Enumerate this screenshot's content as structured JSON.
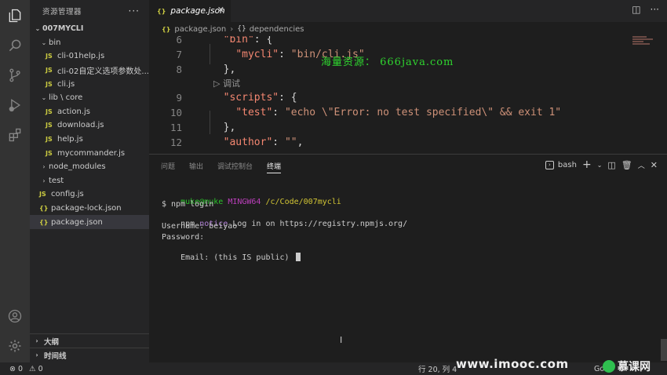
{
  "sidebar": {
    "title": "资源管理器",
    "more": "···",
    "tree": [
      {
        "label": "007MYCLI",
        "kind": "root",
        "chev": "⌄",
        "indent": 4
      },
      {
        "label": "bin",
        "kind": "folder",
        "chev": "⌄",
        "indent": 12
      },
      {
        "label": "cli-01help.js",
        "kind": "js",
        "indent": 20
      },
      {
        "label": "cli-02自定义选项参数处...",
        "kind": "js",
        "indent": 20
      },
      {
        "label": "cli.js",
        "kind": "js",
        "indent": 20
      },
      {
        "label": "lib \\ core",
        "kind": "folder",
        "chev": "⌄",
        "indent": 12
      },
      {
        "label": "action.js",
        "kind": "js",
        "indent": 20
      },
      {
        "label": "download.js",
        "kind": "js",
        "indent": 20
      },
      {
        "label": "help.js",
        "kind": "js",
        "indent": 20
      },
      {
        "label": "mycommander.js",
        "kind": "js",
        "indent": 20
      },
      {
        "label": "node_modules",
        "kind": "folder",
        "chev": "›",
        "indent": 12
      },
      {
        "label": "test",
        "kind": "folder",
        "chev": "›",
        "indent": 12
      },
      {
        "label": "config.js",
        "kind": "js",
        "indent": 12
      },
      {
        "label": "package-lock.json",
        "kind": "json",
        "indent": 12
      },
      {
        "label": "package.json",
        "kind": "json",
        "indent": 12,
        "selected": true
      }
    ],
    "outline_label": "大纲",
    "timeline_label": "时间线"
  },
  "tab": {
    "icon": "{}",
    "label": "package.json",
    "close": "✕"
  },
  "breadcrumb": {
    "file": "package.json",
    "section_icon": "{}",
    "section": "dependencies"
  },
  "editor": {
    "lines": [
      {
        "num": "6",
        "indent": "  ",
        "key": "\"bin\"",
        "rest": ": {"
      },
      {
        "num": "7",
        "indent": "    ",
        "key": "\"mycli\"",
        "rest": ": ",
        "str": "\"bin/cli.js\""
      },
      {
        "num": "8",
        "indent": "  ",
        "rest": "},"
      },
      {
        "num": "9",
        "indent": "  ",
        "key": "\"scripts\"",
        "rest": ": {"
      },
      {
        "num": "10",
        "indent": "    ",
        "key": "\"test\"",
        "rest": ": ",
        "str": "\"echo \\\"Error: no test specified\\\" && exit 1\""
      },
      {
        "num": "11",
        "indent": "  ",
        "rest": "},"
      },
      {
        "num": "12",
        "indent": "  ",
        "key": "\"author\"",
        "rest": ": ",
        "str": "\"\"",
        "tail": ","
      }
    ],
    "codelens": "▷ 调试",
    "watermark": "海量资源：  666java.com"
  },
  "panel": {
    "tabs": [
      "问题",
      "输出",
      "调试控制台",
      "终端"
    ],
    "active_tab": 3,
    "shell": "bash",
    "terminal": {
      "user_host": "muke@muke",
      "msys": "MINGW64",
      "cwd": "/c/Code/007mycli",
      "cmd": "$ npm login",
      "npm": "npm",
      "notice": "notice",
      "notice_text": " Log in on https://registry.npmjs.org/",
      "username": "Username: beiyao",
      "password": "Password:",
      "email": "Email: (this IS public) "
    }
  },
  "statusbar": {
    "errors": "⊗ 0",
    "warnings": "⚠ 0",
    "position": "行 20, 列 4",
    "watermark_site": "www.imooc.com",
    "watermark_brand": "慕课网",
    "right_text": "Go"
  },
  "colors": {
    "json_key": "#f48771",
    "json_string": "#ce9178",
    "terminal_green": "#2bc22b",
    "terminal_purple": "#bc3fbc",
    "terminal_yellow": "#d2c534"
  }
}
